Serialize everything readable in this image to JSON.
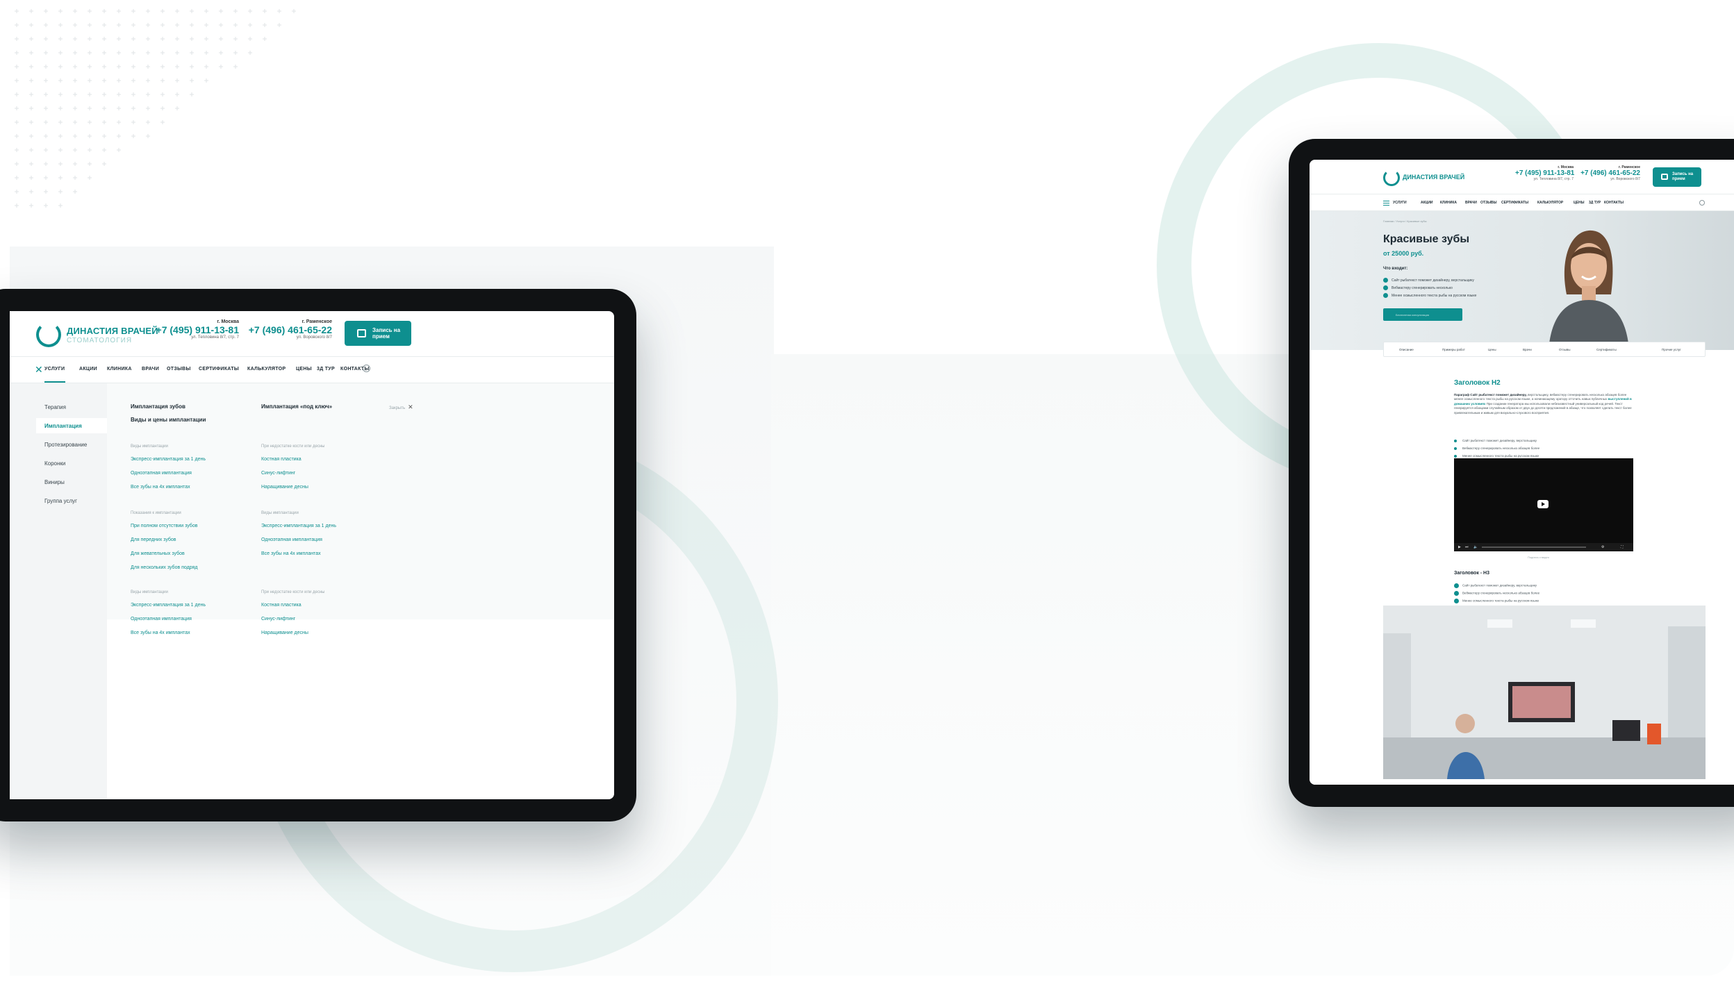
{
  "brand": {
    "name": "ДИНАСТИЯ ВРАЧЕЙ",
    "subtitle": "СТОМАТОЛОГИЯ",
    "accent_color": "#0e8f8f"
  },
  "contacts": [
    {
      "city": "г. Москва",
      "phone": "+7 (495) 911-13-81",
      "address": "ул. Тепловина 8/7, стр. 7"
    },
    {
      "city": "г. Раменское",
      "phone": "+7 (496) 461-65-22",
      "address": "ул. Воровского 8/7"
    }
  ],
  "cta_label": "Запись на прием",
  "icons": [
    "calendar-icon",
    "close-icon",
    "search-icon",
    "menu-icon",
    "check-icon",
    "play-icon"
  ],
  "nav": [
    "УСЛУГИ",
    "АКЦИИ",
    "КЛИНИКА",
    "ВРАЧИ",
    "ОТЗЫВЫ",
    "СЕРТИФИКАТЫ",
    "КАЛЬКУЛЯТОР",
    "ЦЕНЫ",
    "3Д ТУР",
    "КОНТАКТЫ"
  ],
  "menu": {
    "sidebar": [
      "Терапия",
      "Имплантация",
      "Протезирование",
      "Коронки",
      "Виниры",
      "Группа услуг"
    ],
    "active_sidebar": "Имплантация",
    "col1_title": "Имплантация зубов",
    "col1_subtitle": "Виды и цены имплантации",
    "col2_title": "Имплантация «под ключ»",
    "close_label": "Закрыть",
    "groups": [
      {
        "label": "Виды имплантации",
        "links": [
          "Экспресс-имплантация за 1 день",
          "Одноэтапная имплантация",
          "Все зубы на 4х имплантах"
        ]
      },
      {
        "label": "При недостатке кости или десны",
        "links": [
          "Костная пластика",
          "Синус-лифтинг",
          "Наращивание десны"
        ]
      },
      {
        "label": "Показания к имплантации",
        "links": [
          "При полном отсутствии зубов",
          "Для передних зубов",
          "Для жевательных зубов",
          "Для нескольких зубов подряд"
        ]
      },
      {
        "label": "Виды имплантации",
        "links": [
          "Экспресс-имплантация за 1 день",
          "Одноэтапная имплантация",
          "Все зубы на 4х имплантах"
        ]
      },
      {
        "label": "Виды имплантации",
        "links": [
          "Экспресс-имплантация за 1 день",
          "Одноэтапная имплантация",
          "Все зубы на 4х имплантах"
        ]
      },
      {
        "label": "При недостатке кости или десны",
        "links": [
          "Костная пластика",
          "Синус-лифтинг",
          "Наращивание десны"
        ]
      }
    ]
  },
  "service_page": {
    "breadcrumbs": "Главная / Услуги / Красивые зубы",
    "title": "Красивые зубы",
    "price": "от 25000 руб.",
    "includes_label": "Что входит:",
    "includes": [
      "Сайт рыбатекст поможет дизайнеру, верстальщику",
      "Вебмастеру сгенерировать несколько",
      "Менее осмысленного текста рыбы на русском языке"
    ],
    "hero_button": "Бесплатная консультация",
    "tabs": [
      "Описание",
      "Примеры работ",
      "Цены",
      "Врачи",
      "Отзывы",
      "Сертификаты",
      "Прочие услуг"
    ],
    "h2": "Заголовок Н2",
    "paragraph": {
      "lead": "Параграф Сайт рыбатекст поможет дизайнеру,",
      "text": "верстальщику, вебмастеру сгенерировать несколько абзацев более менее осмысленного текста рыбы на русском языке, а начинающему оратору отточить навык публичных",
      "highlight": "выступлений в домашних условиях",
      "tail": "При создании генератора мы использовали небезизвестный универсальный код речей. Текст генерируется абзацами случайным образом от двух до десяти предложений в абзаце, что позволяет сделать текст более привлекательным и живым для визуально-слухового восприятия."
    },
    "bullets": [
      "Сайт рыбатекст поможет дизайнеру, верстальщику",
      "Вебмастеру сгенерировать несколько абзацев более",
      "Менее осмысленного текста рыбы на русском языке"
    ],
    "video_caption": "Подпись к видео",
    "h3": "Заголовок - Н3",
    "checks": [
      "Сайт рыбатекст поможет дизайнеру, верстальщику",
      "Вебмастеру сгенерировать несколько абзацев более",
      "Менее осмысленного текста рыбы на русском языке"
    ]
  }
}
